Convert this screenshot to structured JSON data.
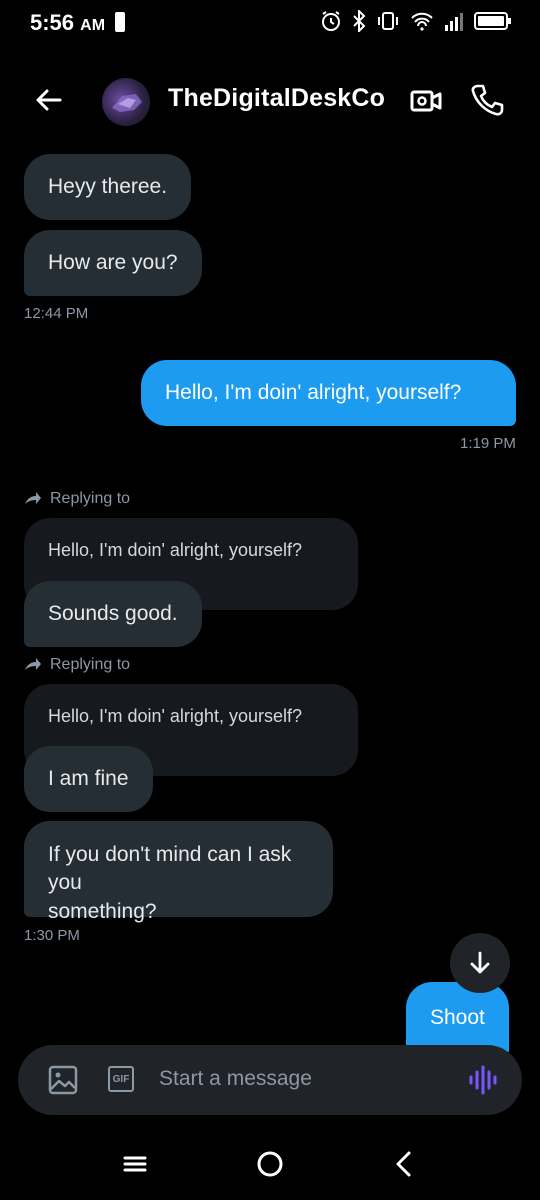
{
  "status_bar": {
    "time": "5:56",
    "ampm": "AM"
  },
  "header": {
    "title": "TheDigitalDeskCo",
    "icons": [
      "back-arrow-icon",
      "avatar",
      "video-call-icon",
      "phone-icon"
    ]
  },
  "messages": {
    "m1": "Heyy thereе.",
    "m2": "How are you?",
    "ts1": "12:44 PM",
    "m3": "Hello, I'm doin' alright, yourself?",
    "ts2": "1:19 PM",
    "reply1": {
      "label": "Replying to",
      "quoted": "Hello, I'm doin' alright, yourself?",
      "text": "Sounds good."
    },
    "reply2": {
      "label": "Replying to",
      "quoted": "Hello, I'm doin' alright, yourself?",
      "text": "I am fine"
    },
    "m4_line1": "If you don't mind can I ask you",
    "m4_line2": "something?",
    "ts3": "1:30 PM",
    "m5": "Shoot"
  },
  "composer": {
    "placeholder": "Start a message",
    "gif_label": "GIF"
  },
  "colors": {
    "accent": "#1d9bf0",
    "incoming_bubble": "#252d35",
    "mic_accent": "#7856ff"
  }
}
